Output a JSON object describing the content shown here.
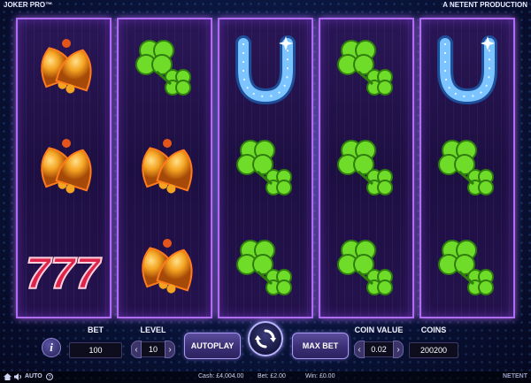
{
  "header": {
    "game_title": "JOKER PRO™",
    "producer": "A NETENT PRODUCTION"
  },
  "reels": [
    {
      "symbols": [
        "bell",
        "bell",
        "seven"
      ]
    },
    {
      "symbols": [
        "clover",
        "bell",
        "bell"
      ]
    },
    {
      "symbols": [
        "horseshoe",
        "clover",
        "clover"
      ]
    },
    {
      "symbols": [
        "clover",
        "clover",
        "clover"
      ]
    },
    {
      "symbols": [
        "horseshoe",
        "clover",
        "clover"
      ]
    }
  ],
  "controls": {
    "info_label": "i",
    "bet_label": "BET",
    "bet_value": "100",
    "level_label": "LEVEL",
    "level_value": "10",
    "autoplay_label": "AUTOPLAY",
    "maxbet_label": "MAX BET",
    "coin_value_label": "COIN VALUE",
    "coin_value": "0.02",
    "coins_label": "COINS",
    "coins_value": "200200",
    "arrow_left": "‹",
    "arrow_right": "›"
  },
  "status": {
    "auto_label": "AUTO",
    "cash": "Cash: £4,004.00",
    "bet": "Bet: £2.00",
    "win": "Win: £0.00",
    "brand": "NETENT"
  },
  "colors": {
    "reel_border": "#b06cf0",
    "bell_gold": "#f4a321",
    "clover_green": "#6fdc2a",
    "horseshoe_blue": "#7cc4ff",
    "seven_red": "#e0234a"
  }
}
